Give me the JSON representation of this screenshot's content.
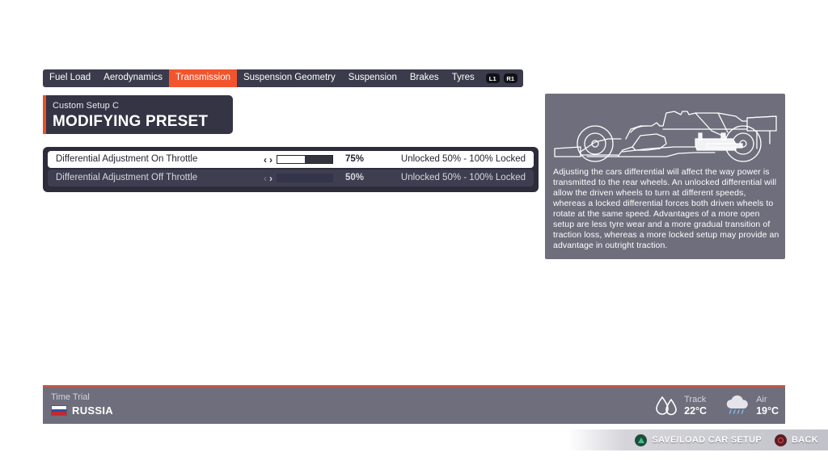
{
  "tabs": [
    {
      "label": "Fuel Load",
      "active": false
    },
    {
      "label": "Aerodynamics",
      "active": false
    },
    {
      "label": "Transmission",
      "active": true
    },
    {
      "label": "Suspension Geometry",
      "active": false
    },
    {
      "label": "Suspension",
      "active": false
    },
    {
      "label": "Brakes",
      "active": false
    },
    {
      "label": "Tyres",
      "active": false
    }
  ],
  "bumpers": {
    "left": "L1",
    "right": "R1"
  },
  "preset": {
    "subtitle": "Custom Setup  C",
    "title": "MODIFYING PRESET"
  },
  "settings": {
    "rows": [
      {
        "label": "Differential Adjustment On Throttle",
        "value": "75%",
        "fill_percent": 50,
        "range": "Unlocked 50% - 100% Locked",
        "selected": true,
        "arrow_left": "‹",
        "arrow_right": "›"
      },
      {
        "label": "Differential Adjustment Off Throttle",
        "value": "50%",
        "fill_percent": 0,
        "range": "Unlocked 50% - 100% Locked",
        "selected": false,
        "arrow_left": "‹",
        "arrow_right": "›"
      }
    ]
  },
  "info": {
    "illustration": "f1-car-side-view-differential-highlight",
    "description": "Adjusting the cars differential will affect the way power is transmitted to the rear wheels. An unlocked differential will allow the driven wheels to turn at different speeds, whereas a locked differential forces both driven wheels to rotate at the same speed. Advantages of a more open setup are less tyre wear and a more gradual transition of traction loss, whereas a more locked setup may provide an advantage in outright traction."
  },
  "status_bar": {
    "mode": "Time Trial",
    "country": "RUSSIA",
    "flag": "russia-flag",
    "weather": [
      {
        "label": "Track",
        "value": "22°C",
        "icon": "water-droplets-icon"
      },
      {
        "label": "Air",
        "value": "19°C",
        "icon": "rain-cloud-icon"
      }
    ]
  },
  "prompts": [
    {
      "button": "triangle-button",
      "label": "SAVE/LOAD CAR SETUP"
    },
    {
      "button": "circle-button",
      "label": "BACK"
    }
  ],
  "colors": {
    "accent": "#f2542d",
    "header_accent": "#e8502b",
    "tabbar_bg": "#3b3b4c",
    "panel_bg": "#2c2c3b",
    "row_unselected": "#3e3e50",
    "info_panel_bg": "#6e6e7c",
    "page_bg": "#ffffff"
  }
}
